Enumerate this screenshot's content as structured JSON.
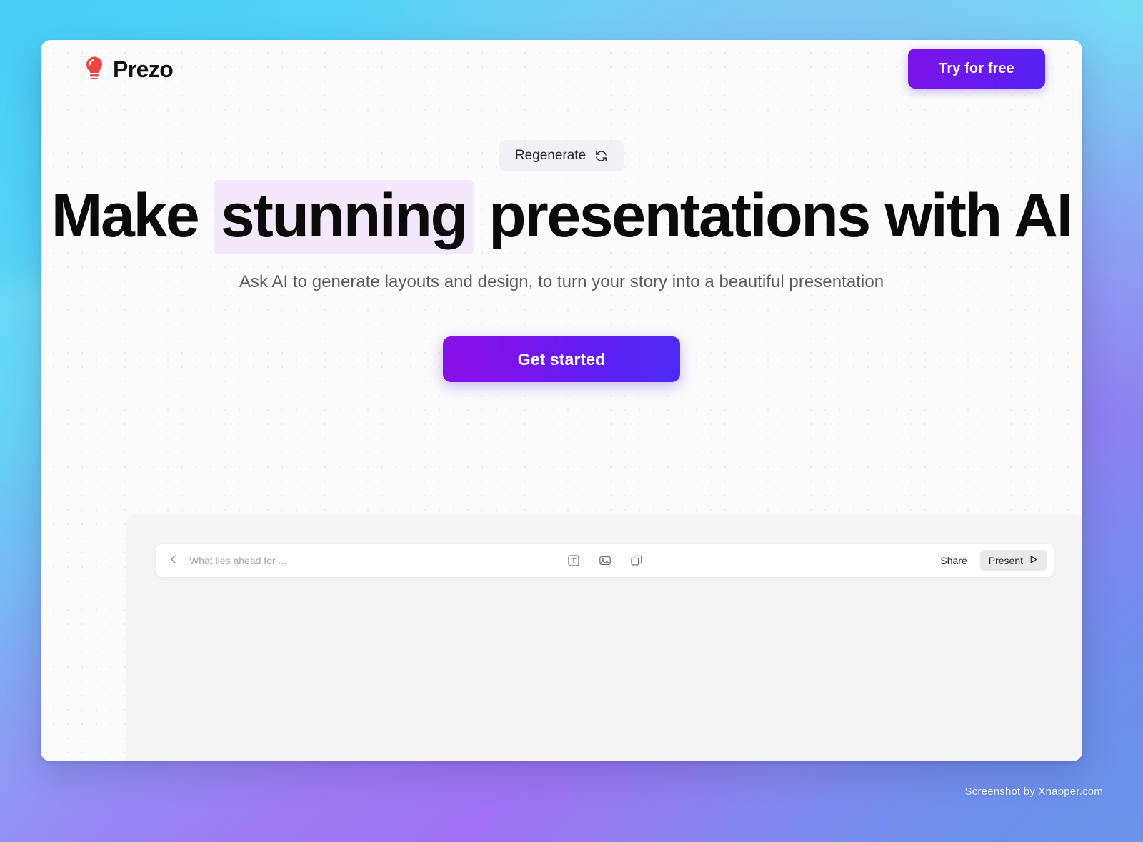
{
  "background": {
    "gradient_from": "#52D2F5",
    "gradient_mid": "#A47DF4",
    "gradient_to": "#6490E8"
  },
  "window": {
    "background": "#FBFBFB"
  },
  "header": {
    "brand_name": "Prezo",
    "brand_icon": "lightbulb-icon",
    "brand_icon_color": "#EF4444",
    "cta_label": "Try for free",
    "cta_color": "#6C19EE"
  },
  "hero": {
    "regenerate_label": "Regenerate",
    "regenerate_icon": "refresh-icon",
    "headline_part1": "Make ",
    "headline_highlight": "stunning",
    "headline_part2": " presentations with AI",
    "highlight_color": "#F2E7FB",
    "subhead": "Ask AI to generate layouts and design, to turn your story into a beautiful presentation",
    "primary_cta_label": "Get started",
    "primary_cta_color": "#6C19EE"
  },
  "editor": {
    "back_icon": "chevron-left-icon",
    "document_title": "What lies ahead for ...",
    "tools": [
      {
        "name": "text-tool-icon",
        "label": "Text"
      },
      {
        "name": "image-tool-icon",
        "label": "Image"
      },
      {
        "name": "shape-tool-icon",
        "label": "Shape"
      }
    ],
    "share_label": "Share",
    "present_label": "Present",
    "present_icon": "play-icon"
  },
  "watermark": {
    "text": "Screenshot by Xnapper.com"
  }
}
